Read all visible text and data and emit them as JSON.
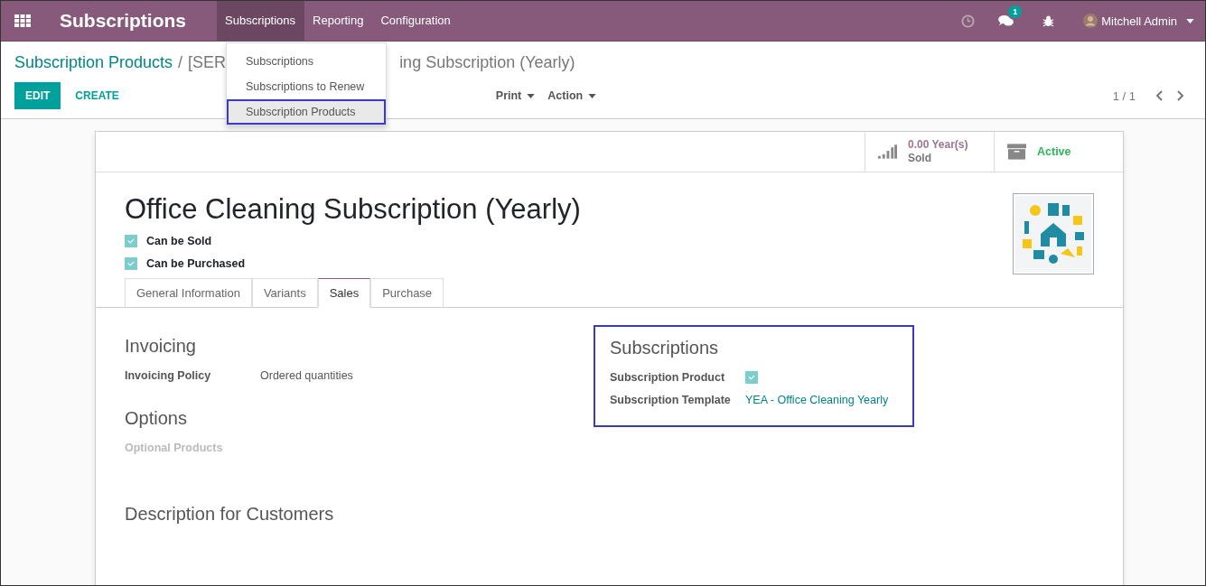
{
  "navbar": {
    "app_title": "Subscriptions",
    "menu": [
      {
        "label": "Subscriptions",
        "selected": true
      },
      {
        "label": "Reporting",
        "selected": false
      },
      {
        "label": "Configuration",
        "selected": false
      }
    ],
    "message_count": "1",
    "user": "Mitchell Admin"
  },
  "dropdown": {
    "items": [
      {
        "label": "Subscriptions",
        "highlighted": false
      },
      {
        "label": "Subscriptions to Renew",
        "highlighted": false
      },
      {
        "label": "Subscription Products",
        "highlighted": true
      }
    ]
  },
  "breadcrumb": {
    "parent": "Subscription Products",
    "separator": "/",
    "current_start": "[SER",
    "current_end": "ing Subscription (Yearly)"
  },
  "buttons": {
    "edit": "EDIT",
    "create": "CREATE"
  },
  "actions": [
    "Print",
    "Action"
  ],
  "pager": "1 / 1",
  "stat_buttons": [
    {
      "kind": "sold",
      "value": "0.00 Year(s)",
      "label": "Sold"
    },
    {
      "kind": "active",
      "label": "Active"
    }
  ],
  "product": {
    "name": "Office Cleaning Subscription (Yearly)",
    "checkboxes": [
      {
        "label": "Can be Sold",
        "checked": true
      },
      {
        "label": "Can be Purchased",
        "checked": true
      }
    ]
  },
  "tabs": [
    {
      "label": "General Information",
      "selected": false
    },
    {
      "label": "Variants",
      "selected": false
    },
    {
      "label": "Sales",
      "selected": true
    },
    {
      "label": "Purchase",
      "selected": false
    }
  ],
  "groups": [
    {
      "title": "Invoicing",
      "fields": [
        {
          "kind": "text",
          "label": "Invoicing Policy",
          "value": "Ordered quantities"
        }
      ]
    },
    {
      "title": "Subscriptions",
      "highlighted": true,
      "fields": [
        {
          "kind": "checkbox",
          "label": "Subscription Product",
          "checked": true
        },
        {
          "kind": "link",
          "label": "Subscription Template",
          "value": "YEA - Office Cleaning Yearly"
        }
      ]
    },
    {
      "title": "Options",
      "fields": [
        {
          "kind": "empty",
          "label": "Optional Products"
        }
      ]
    }
  ],
  "description": {
    "title": "Description for Customers"
  }
}
